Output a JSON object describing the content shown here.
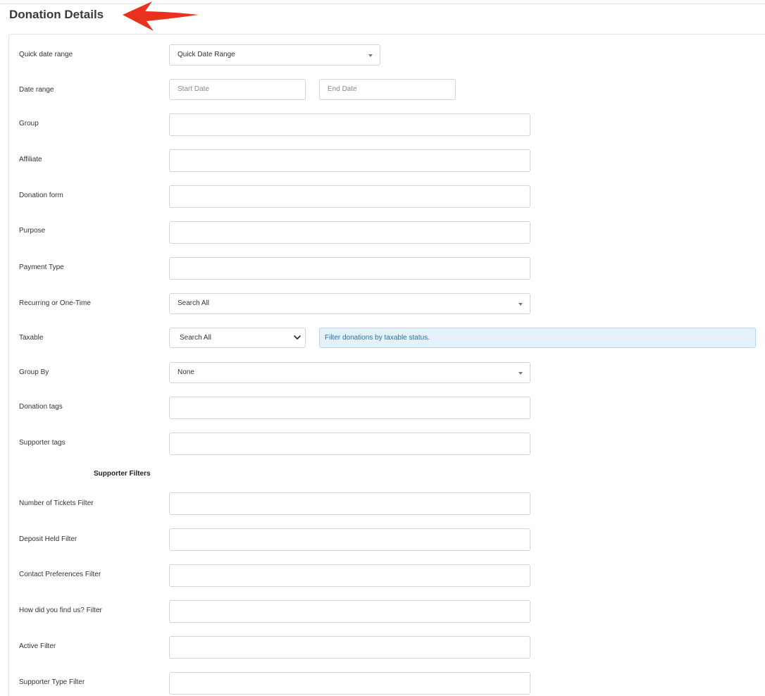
{
  "page": {
    "title": "Donation Details"
  },
  "filters": {
    "quick_date_range": {
      "label": "Quick date range",
      "value": "Quick Date Range"
    },
    "date_range": {
      "label": "Date range",
      "start_placeholder": "Start Date",
      "end_placeholder": "End Date"
    },
    "group": {
      "label": "Group",
      "value": ""
    },
    "affiliate": {
      "label": "Affiliate",
      "value": ""
    },
    "donation_form": {
      "label": "Donation form",
      "value": ""
    },
    "purpose": {
      "label": "Purpose",
      "value": ""
    },
    "payment_type": {
      "label": "Payment Type",
      "value": ""
    },
    "recurring": {
      "label": "Recurring or One-Time",
      "value": "Search All"
    },
    "taxable": {
      "label": "Taxable",
      "value": "Search All",
      "hint": "Filter donations by taxable status."
    },
    "group_by": {
      "label": "Group By",
      "value": "None"
    },
    "donation_tags": {
      "label": "Donation tags",
      "value": ""
    },
    "supporter_tags": {
      "label": "Supporter tags",
      "value": ""
    }
  },
  "supporter_filters": {
    "heading": "Supporter Filters",
    "tickets": {
      "label": "Number of Tickets Filter",
      "value": ""
    },
    "deposit_held": {
      "label": "Deposit Held Filter",
      "value": ""
    },
    "contact_preferences": {
      "label": "Contact Preferences Filter",
      "value": ""
    },
    "how_found": {
      "label": "How did you find us? Filter",
      "value": ""
    },
    "active": {
      "label": "Active Filter",
      "value": ""
    },
    "supporter_type": {
      "label": "Supporter Type Filter",
      "value": ""
    }
  },
  "annotation": {
    "arrow_color": "#e8321e"
  }
}
